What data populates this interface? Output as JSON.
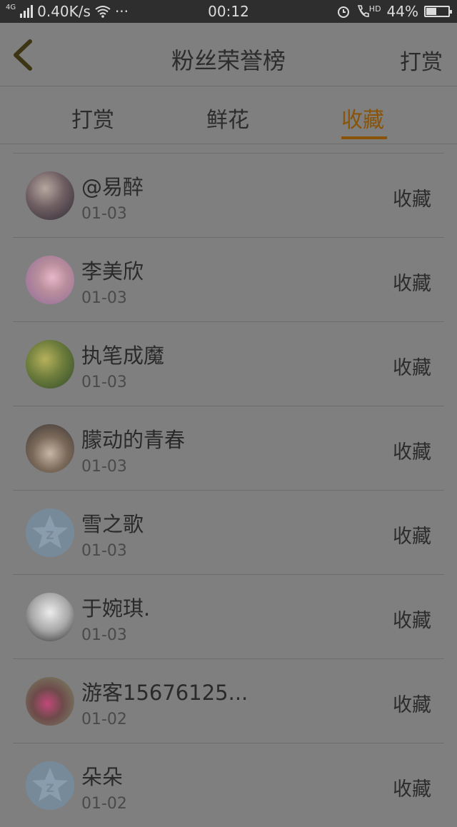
{
  "status": {
    "network": "4G",
    "speed": "0.40K/s",
    "dots": "···",
    "time": "00:12",
    "hd": "HD",
    "battery": "44%",
    "battery_level": 0.44
  },
  "header": {
    "title": "粉丝荣誉榜",
    "right_action": "打赏"
  },
  "tabs": [
    {
      "label": "打赏"
    },
    {
      "label": "鲜花"
    },
    {
      "label": "收藏"
    }
  ],
  "list": [
    {
      "name": "@易醉",
      "date": "01-03",
      "action": "收藏"
    },
    {
      "name": "李美欣",
      "date": "01-03",
      "action": "收藏"
    },
    {
      "name": "执笔成魔",
      "date": "01-03",
      "action": "收藏"
    },
    {
      "name": "朦动的青春",
      "date": "01-03",
      "action": "收藏"
    },
    {
      "name": "雪之歌",
      "date": "01-03",
      "action": "收藏"
    },
    {
      "name": "于婉琪.",
      "date": "01-03",
      "action": "收藏"
    },
    {
      "name": "游客15676125...",
      "date": "01-02",
      "action": "收藏"
    },
    {
      "name": "朵朵",
      "date": "01-02",
      "action": "收藏"
    }
  ],
  "colors": {
    "accent": "#8a5408",
    "overlay": "#7f7f7f"
  }
}
